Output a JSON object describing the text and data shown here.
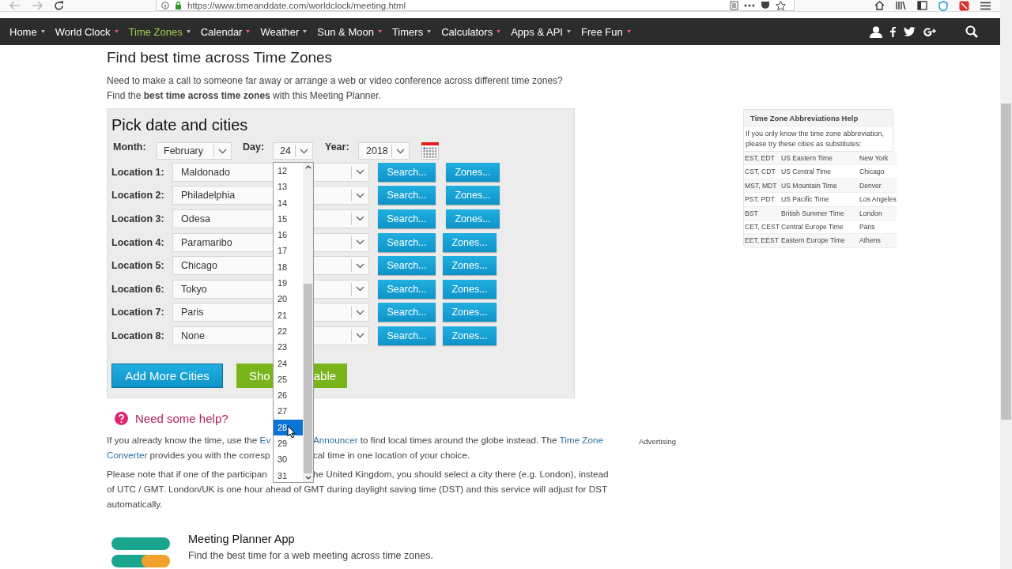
{
  "browser": {
    "url": "https://www.timeanddate.com/worldclock/meeting.html"
  },
  "nav": {
    "items": [
      {
        "label": "Home",
        "selected": false
      },
      {
        "label": "World Clock",
        "selected": false
      },
      {
        "label": "Time Zones",
        "selected": true
      },
      {
        "label": "Calendar",
        "selected": false
      },
      {
        "label": "Weather",
        "selected": false
      },
      {
        "label": "Sun & Moon",
        "selected": false
      },
      {
        "label": "Timers",
        "selected": false
      },
      {
        "label": "Calculators",
        "selected": false
      },
      {
        "label": "Apps & API",
        "selected": false
      },
      {
        "label": "Free Fun",
        "selected": false
      }
    ]
  },
  "title": "Find best time across Time Zones",
  "intro": [
    "Need to make a call to someone far away or arrange a web or video conference across different time zones?",
    "Find the **best time across time zones** with this Meeting Planner."
  ],
  "form": {
    "title": "Pick date and cities",
    "month": {
      "label": "Month:",
      "value": "February"
    },
    "day": {
      "label": "Day:",
      "value": "24"
    },
    "year": {
      "label": "Year:",
      "value": "2018"
    },
    "locations": [
      {
        "label": "Location 1:",
        "value": "Maldonado",
        "search": "Search...",
        "zones": "Zones..."
      },
      {
        "label": "Location 2:",
        "value": "Philadelphia",
        "search": "Search...",
        "zones": "Zones..."
      },
      {
        "label": "Location 3:",
        "value": "Odesa",
        "search": "Search...",
        "zones": "Zones..."
      },
      {
        "label": "Location 4:",
        "value": "Paramaribo",
        "search": "Search...",
        "zones": "Zones..."
      },
      {
        "label": "Location 5:",
        "value": "Chicago",
        "search": "Search...",
        "zones": "Zones..."
      },
      {
        "label": "Location 6:",
        "value": "Tokyo",
        "search": "Search...",
        "zones": "Zones..."
      },
      {
        "label": "Location 7:",
        "value": "Paris",
        "search": "Search...",
        "zones": "Zones..."
      },
      {
        "label": "Location 8:",
        "value": "None",
        "search": "Search...",
        "zones": "Zones..."
      }
    ],
    "add_button": "Add More Cities",
    "show_button": {
      "left": "Sho",
      "right": "able"
    }
  },
  "day_dropdown": {
    "options": [
      {
        "label": "12",
        "selected": false
      },
      {
        "label": "13",
        "selected": false
      },
      {
        "label": "14",
        "selected": false
      },
      {
        "label": "15",
        "selected": false
      },
      {
        "label": "16",
        "selected": false
      },
      {
        "label": "17",
        "selected": false
      },
      {
        "label": "18",
        "selected": false
      },
      {
        "label": "19",
        "selected": false
      },
      {
        "label": "20",
        "selected": false
      },
      {
        "label": "21",
        "selected": false
      },
      {
        "label": "22",
        "selected": false
      },
      {
        "label": "23",
        "selected": false
      },
      {
        "label": "24",
        "selected": false
      },
      {
        "label": "25",
        "selected": false
      },
      {
        "label": "26",
        "selected": false
      },
      {
        "label": "27",
        "selected": false
      },
      {
        "label": "28",
        "selected": true
      },
      {
        "label": "29",
        "selected": false
      },
      {
        "label": "30",
        "selected": false
      },
      {
        "label": "31",
        "selected": false
      }
    ]
  },
  "help": {
    "title": "Need some help?",
    "paragraphs": [
      {
        "lines": [
          {
            "left": [
              {
                "text": "If you already know the time, use the "
              },
              {
                "text": "Ev",
                "link": true
              }
            ],
            "right": [
              {
                "text": "Announcer",
                "link": true
              },
              {
                "text": " to find local times around the globe instead. The "
              },
              {
                "text": "Time Zone",
                "link": true
              }
            ]
          },
          {
            "left": [
              {
                "text": "Converter",
                "link": true
              },
              {
                "text": " provides you with the corresp"
              }
            ],
            "right": [
              {
                "text": "cal time in one location of your choice."
              }
            ]
          }
        ]
      },
      {
        "lines": [
          {
            "left": [
              {
                "text": "Please note that if one of the participan"
              }
            ],
            "right": [
              {
                "text": "he United Kingdom, you should select a city there (e.g. London), instead"
              }
            ]
          },
          {
            "left": [
              {
                "text": "of UTC / GMT. London/UK is one hour ahead of GMT during daylight saving time (DST) and this service will adjust for DST"
              }
            ]
          },
          {
            "left": [
              {
                "text": "automatically."
              }
            ]
          }
        ]
      }
    ]
  },
  "advertising": "Advertising",
  "app": {
    "title": "Meeting Planner App",
    "text": "Find the best time for a web meeting across time zones."
  },
  "tz_help": {
    "title": "Time Zone Abbreviations Help",
    "note": "If you only know the time zone abbreviation, please try these cities as substitutes:",
    "rows": [
      [
        "EST, EDT",
        "US Eastern Time",
        "New York"
      ],
      [
        "CST, CDT",
        "US Central Time",
        "Chicago"
      ],
      [
        "MST, MDT",
        "US Mountain Time",
        "Denver"
      ],
      [
        "PST, PDT",
        "US Pacific Time",
        "Los Angeles"
      ],
      [
        "BST",
        "British Summer Time",
        "London"
      ],
      [
        "CET, CEST",
        "Central Europe Time",
        "Paris"
      ],
      [
        "EET, EEST",
        "Eastern Europe Time",
        "Athens"
      ]
    ]
  }
}
